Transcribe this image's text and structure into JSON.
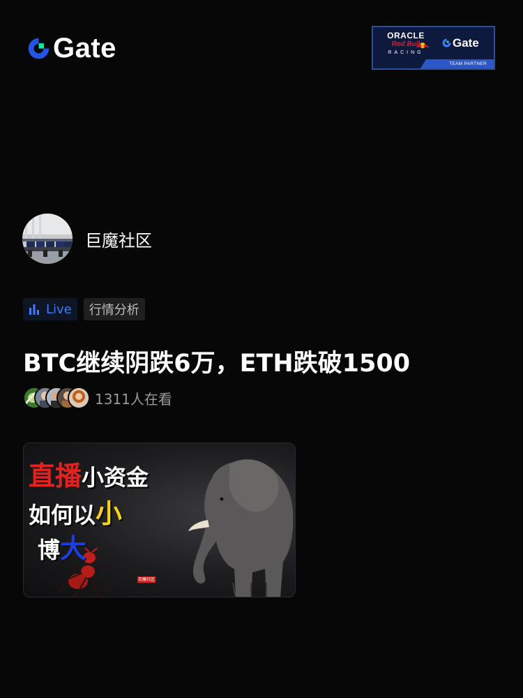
{
  "brand": {
    "name": "Gate",
    "logo_icon": "gate-logo-icon",
    "colors": {
      "mark_blue": "#2354e6",
      "mark_green": "#17e6a1"
    }
  },
  "partner_badge": {
    "oracle": "ORACLE",
    "redbull": "Red Bull",
    "racing": "RACING",
    "brand": "Gate",
    "caption": "TEAM PARTNER"
  },
  "community": {
    "name": "巨魔社区",
    "avatar_icon": "trading-room-photo"
  },
  "tags": {
    "live_label": "Live",
    "live_icon": "bar-chart-icon",
    "category_label": "行情分析",
    "live_color": "#3d7bff"
  },
  "stream": {
    "title": "BTC继续阴跌6万，ETH跌破1500",
    "viewer_count": "1311人在看"
  },
  "thumbnail": {
    "line1_red": "直播",
    "line1_white": "小资金",
    "line2_white": "如何以",
    "line2_yellow": "小",
    "line3_white": "博",
    "line3_blue": "大",
    "stamp": "巨魔社区"
  }
}
